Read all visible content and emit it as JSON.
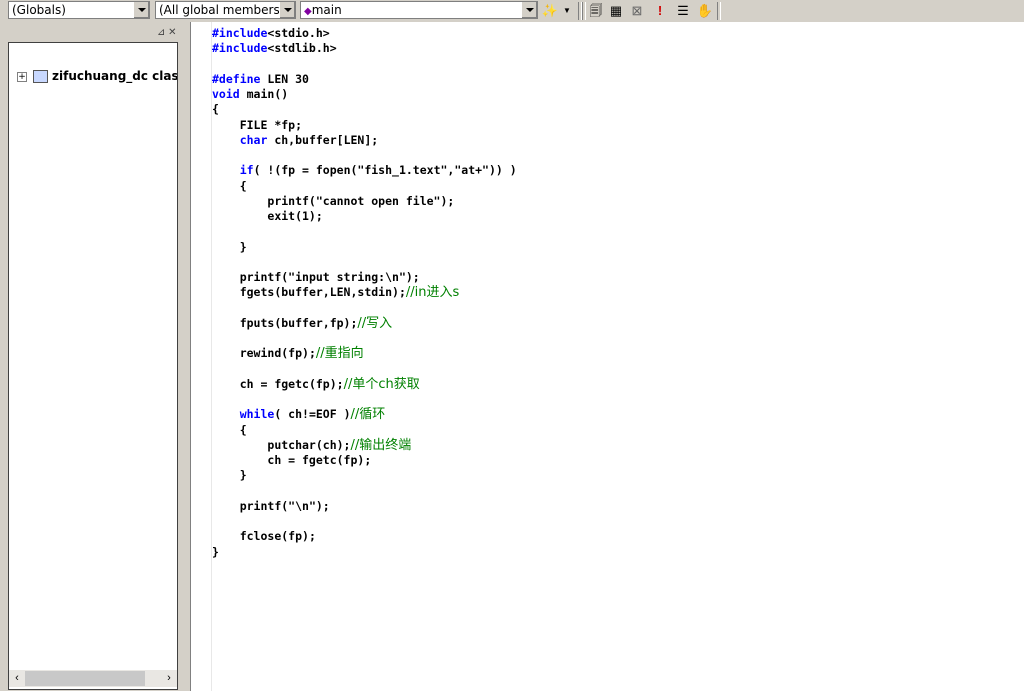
{
  "toolbar": {
    "scope_combo": "(Globals)",
    "members_combo": "(All global members",
    "function_combo": "main",
    "icons": [
      "wizard-icon",
      "compile-icon",
      "build-icon",
      "stop-build-icon",
      "execute-icon",
      "breakpoint-list-icon",
      "hand-icon"
    ]
  },
  "tree": {
    "root_label": "zifuchuang_dc class"
  },
  "colors": {
    "keyword": "#0000ff",
    "comment": "#008000",
    "text": "#000000"
  },
  "code_lines": [
    {
      "indent": "",
      "kw": "#include",
      "text": "<stdio.h>",
      "comment": ""
    },
    {
      "indent": "",
      "kw": "#include",
      "text": "<stdlib.h>",
      "comment": ""
    },
    {
      "indent": "",
      "kw": "",
      "text": "",
      "comment": ""
    },
    {
      "indent": "",
      "kw": "#define",
      "text": " LEN 30",
      "comment": ""
    },
    {
      "indent": "",
      "kw": "void",
      "text": " main()",
      "comment": ""
    },
    {
      "indent": "",
      "kw": "",
      "text": "{",
      "comment": ""
    },
    {
      "indent": "    ",
      "kw": "",
      "text": "FILE *fp;",
      "comment": ""
    },
    {
      "indent": "    ",
      "kw": "char",
      "text": " ch,buffer[LEN];",
      "comment": ""
    },
    {
      "indent": "",
      "kw": "",
      "text": "",
      "comment": ""
    },
    {
      "indent": "    ",
      "kw": "if",
      "text": "( !(fp = fopen(\"fish_1.text\",\"at+\")) )",
      "comment": ""
    },
    {
      "indent": "    ",
      "kw": "",
      "text": "{",
      "comment": ""
    },
    {
      "indent": "        ",
      "kw": "",
      "text": "printf(\"cannot open file\");",
      "comment": ""
    },
    {
      "indent": "        ",
      "kw": "",
      "text": "exit(1);",
      "comment": ""
    },
    {
      "indent": "",
      "kw": "",
      "text": "",
      "comment": ""
    },
    {
      "indent": "    ",
      "kw": "",
      "text": "}",
      "comment": ""
    },
    {
      "indent": "",
      "kw": "",
      "text": "",
      "comment": ""
    },
    {
      "indent": "    ",
      "kw": "",
      "text": "printf(\"input string:\\n\");",
      "comment": ""
    },
    {
      "indent": "    ",
      "kw": "",
      "text": "fgets(buffer,LEN,stdin);",
      "comment": "//in进入s"
    },
    {
      "indent": "",
      "kw": "",
      "text": "",
      "comment": ""
    },
    {
      "indent": "    ",
      "kw": "",
      "text": "fputs(buffer,fp);",
      "comment": "//写入"
    },
    {
      "indent": "",
      "kw": "",
      "text": "",
      "comment": ""
    },
    {
      "indent": "    ",
      "kw": "",
      "text": "rewind(fp);",
      "comment": "//重指向"
    },
    {
      "indent": "",
      "kw": "",
      "text": "",
      "comment": ""
    },
    {
      "indent": "    ",
      "kw": "",
      "text": "ch = fgetc(fp);",
      "comment": "//单个ch获取"
    },
    {
      "indent": "",
      "kw": "",
      "text": "",
      "comment": ""
    },
    {
      "indent": "    ",
      "kw": "while",
      "text": "( ch!=EOF )",
      "comment": "//循环"
    },
    {
      "indent": "    ",
      "kw": "",
      "text": "{",
      "comment": ""
    },
    {
      "indent": "        ",
      "kw": "",
      "text": "putchar(ch);",
      "comment": "//输出终端"
    },
    {
      "indent": "        ",
      "kw": "",
      "text": "ch = fgetc(fp);",
      "comment": ""
    },
    {
      "indent": "    ",
      "kw": "",
      "text": "}",
      "comment": ""
    },
    {
      "indent": "",
      "kw": "",
      "text": "",
      "comment": ""
    },
    {
      "indent": "    ",
      "kw": "",
      "text": "printf(\"\\n\");",
      "comment": ""
    },
    {
      "indent": "",
      "kw": "",
      "text": "",
      "comment": ""
    },
    {
      "indent": "    ",
      "kw": "",
      "text": "fclose(fp);",
      "comment": ""
    },
    {
      "indent": "",
      "kw": "",
      "text": "}",
      "comment": ""
    }
  ]
}
